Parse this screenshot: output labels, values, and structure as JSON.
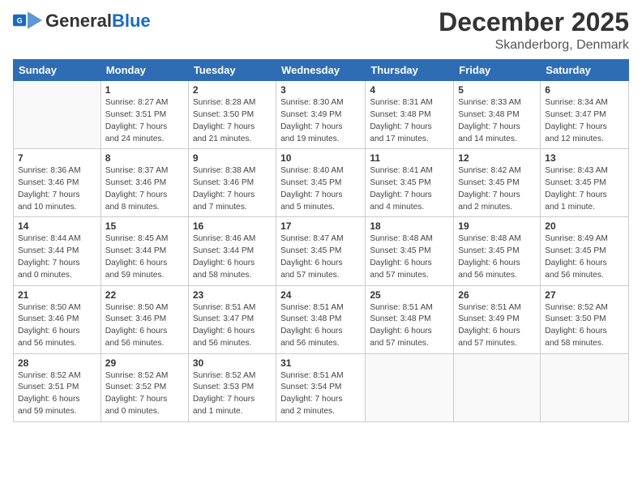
{
  "header": {
    "logo_general": "General",
    "logo_blue": "Blue",
    "month": "December 2025",
    "location": "Skanderborg, Denmark"
  },
  "weekdays": [
    "Sunday",
    "Monday",
    "Tuesday",
    "Wednesday",
    "Thursday",
    "Friday",
    "Saturday"
  ],
  "weeks": [
    [
      {
        "day": "",
        "info": ""
      },
      {
        "day": "1",
        "info": "Sunrise: 8:27 AM\nSunset: 3:51 PM\nDaylight: 7 hours\nand 24 minutes."
      },
      {
        "day": "2",
        "info": "Sunrise: 8:28 AM\nSunset: 3:50 PM\nDaylight: 7 hours\nand 21 minutes."
      },
      {
        "day": "3",
        "info": "Sunrise: 8:30 AM\nSunset: 3:49 PM\nDaylight: 7 hours\nand 19 minutes."
      },
      {
        "day": "4",
        "info": "Sunrise: 8:31 AM\nSunset: 3:48 PM\nDaylight: 7 hours\nand 17 minutes."
      },
      {
        "day": "5",
        "info": "Sunrise: 8:33 AM\nSunset: 3:48 PM\nDaylight: 7 hours\nand 14 minutes."
      },
      {
        "day": "6",
        "info": "Sunrise: 8:34 AM\nSunset: 3:47 PM\nDaylight: 7 hours\nand 12 minutes."
      }
    ],
    [
      {
        "day": "7",
        "info": "Sunrise: 8:36 AM\nSunset: 3:46 PM\nDaylight: 7 hours\nand 10 minutes."
      },
      {
        "day": "8",
        "info": "Sunrise: 8:37 AM\nSunset: 3:46 PM\nDaylight: 7 hours\nand 8 minutes."
      },
      {
        "day": "9",
        "info": "Sunrise: 8:38 AM\nSunset: 3:46 PM\nDaylight: 7 hours\nand 7 minutes."
      },
      {
        "day": "10",
        "info": "Sunrise: 8:40 AM\nSunset: 3:45 PM\nDaylight: 7 hours\nand 5 minutes."
      },
      {
        "day": "11",
        "info": "Sunrise: 8:41 AM\nSunset: 3:45 PM\nDaylight: 7 hours\nand 4 minutes."
      },
      {
        "day": "12",
        "info": "Sunrise: 8:42 AM\nSunset: 3:45 PM\nDaylight: 7 hours\nand 2 minutes."
      },
      {
        "day": "13",
        "info": "Sunrise: 8:43 AM\nSunset: 3:45 PM\nDaylight: 7 hours\nand 1 minute."
      }
    ],
    [
      {
        "day": "14",
        "info": "Sunrise: 8:44 AM\nSunset: 3:44 PM\nDaylight: 7 hours\nand 0 minutes."
      },
      {
        "day": "15",
        "info": "Sunrise: 8:45 AM\nSunset: 3:44 PM\nDaylight: 6 hours\nand 59 minutes."
      },
      {
        "day": "16",
        "info": "Sunrise: 8:46 AM\nSunset: 3:44 PM\nDaylight: 6 hours\nand 58 minutes."
      },
      {
        "day": "17",
        "info": "Sunrise: 8:47 AM\nSunset: 3:45 PM\nDaylight: 6 hours\nand 57 minutes."
      },
      {
        "day": "18",
        "info": "Sunrise: 8:48 AM\nSunset: 3:45 PM\nDaylight: 6 hours\nand 57 minutes."
      },
      {
        "day": "19",
        "info": "Sunrise: 8:48 AM\nSunset: 3:45 PM\nDaylight: 6 hours\nand 56 minutes."
      },
      {
        "day": "20",
        "info": "Sunrise: 8:49 AM\nSunset: 3:45 PM\nDaylight: 6 hours\nand 56 minutes."
      }
    ],
    [
      {
        "day": "21",
        "info": "Sunrise: 8:50 AM\nSunset: 3:46 PM\nDaylight: 6 hours\nand 56 minutes."
      },
      {
        "day": "22",
        "info": "Sunrise: 8:50 AM\nSunset: 3:46 PM\nDaylight: 6 hours\nand 56 minutes."
      },
      {
        "day": "23",
        "info": "Sunrise: 8:51 AM\nSunset: 3:47 PM\nDaylight: 6 hours\nand 56 minutes."
      },
      {
        "day": "24",
        "info": "Sunrise: 8:51 AM\nSunset: 3:48 PM\nDaylight: 6 hours\nand 56 minutes."
      },
      {
        "day": "25",
        "info": "Sunrise: 8:51 AM\nSunset: 3:48 PM\nDaylight: 6 hours\nand 57 minutes."
      },
      {
        "day": "26",
        "info": "Sunrise: 8:51 AM\nSunset: 3:49 PM\nDaylight: 6 hours\nand 57 minutes."
      },
      {
        "day": "27",
        "info": "Sunrise: 8:52 AM\nSunset: 3:50 PM\nDaylight: 6 hours\nand 58 minutes."
      }
    ],
    [
      {
        "day": "28",
        "info": "Sunrise: 8:52 AM\nSunset: 3:51 PM\nDaylight: 6 hours\nand 59 minutes."
      },
      {
        "day": "29",
        "info": "Sunrise: 8:52 AM\nSunset: 3:52 PM\nDaylight: 7 hours\nand 0 minutes."
      },
      {
        "day": "30",
        "info": "Sunrise: 8:52 AM\nSunset: 3:53 PM\nDaylight: 7 hours\nand 1 minute."
      },
      {
        "day": "31",
        "info": "Sunrise: 8:51 AM\nSunset: 3:54 PM\nDaylight: 7 hours\nand 2 minutes."
      },
      {
        "day": "",
        "info": ""
      },
      {
        "day": "",
        "info": ""
      },
      {
        "day": "",
        "info": ""
      }
    ]
  ]
}
